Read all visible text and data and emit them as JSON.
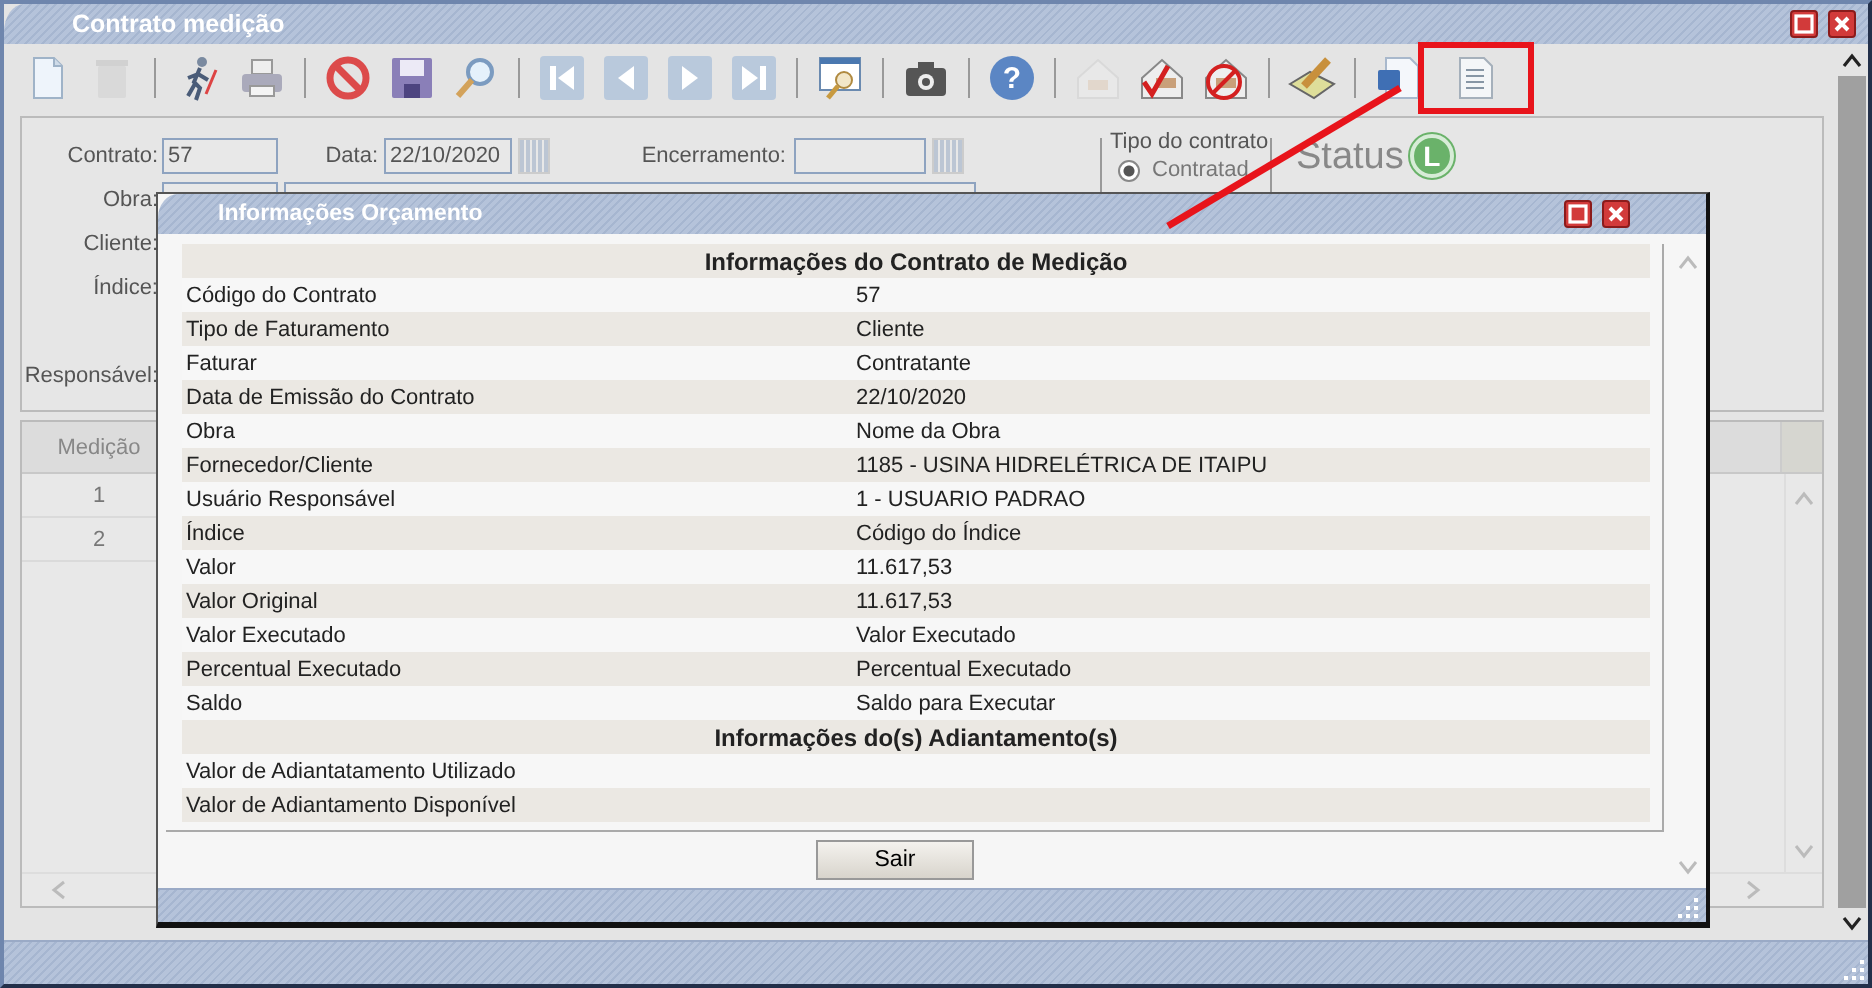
{
  "window": {
    "title": "Contrato medição"
  },
  "toolbar": [
    {
      "kind": "new",
      "disabled": false,
      "highlighted": false
    },
    {
      "kind": "delete",
      "disabled": true,
      "highlighted": false
    },
    {
      "kind": "separator"
    },
    {
      "kind": "runner",
      "disabled": false,
      "highlighted": false
    },
    {
      "kind": "print",
      "disabled": false,
      "highlighted": false
    },
    {
      "kind": "separator"
    },
    {
      "kind": "cancel",
      "disabled": false,
      "highlighted": false
    },
    {
      "kind": "save",
      "disabled": false,
      "highlighted": false
    },
    {
      "kind": "search",
      "disabled": false,
      "highlighted": false
    },
    {
      "kind": "separator"
    },
    {
      "kind": "first",
      "disabled": false,
      "highlighted": false
    },
    {
      "kind": "prev",
      "disabled": false,
      "highlighted": false
    },
    {
      "kind": "next",
      "disabled": false,
      "highlighted": false
    },
    {
      "kind": "last",
      "disabled": false,
      "highlighted": false
    },
    {
      "kind": "separator"
    },
    {
      "kind": "preview",
      "disabled": false,
      "highlighted": false
    },
    {
      "kind": "separator"
    },
    {
      "kind": "camera",
      "disabled": false,
      "highlighted": false
    },
    {
      "kind": "separator"
    },
    {
      "kind": "help",
      "glyph": "?",
      "disabled": false,
      "highlighted": false
    },
    {
      "kind": "separator"
    },
    {
      "kind": "house",
      "disabled": true,
      "highlighted": false
    },
    {
      "kind": "house-check",
      "disabled": false,
      "highlighted": false
    },
    {
      "kind": "house-block",
      "disabled": false,
      "highlighted": false
    },
    {
      "kind": "separator"
    },
    {
      "kind": "edit",
      "disabled": false,
      "highlighted": false
    },
    {
      "kind": "separator"
    },
    {
      "kind": "word",
      "disabled": false,
      "highlighted": false
    },
    {
      "kind": "report",
      "disabled": false,
      "highlighted": true
    }
  ],
  "form": {
    "contrato_label": "Contrato:",
    "contrato": "57",
    "data_label": "Data:",
    "data": "22/10/2020",
    "encerramento_label": "Encerramento:",
    "obra_label": "Obra:",
    "cliente_label": "Cliente:",
    "indice_label": "Índice:",
    "responsavel_label": "Responsável:",
    "tipo_legend": "Tipo do contrato",
    "tipo_option": {
      "label": "Contratad",
      "selected": true
    },
    "status_label": "Status",
    "status_badge": "L"
  },
  "grid": {
    "columns": [
      "Medição"
    ],
    "rows": [
      "1",
      "2"
    ]
  },
  "dialog": {
    "title": "Informações Orçamento",
    "sections": [
      {
        "heading": "Informações do Contrato de Medição",
        "rows": [
          {
            "label": "Código do Contrato",
            "value": "57"
          },
          {
            "label": "Tipo de Faturamento",
            "value": "Cliente"
          },
          {
            "label": "Faturar",
            "value": "Contratante"
          },
          {
            "label": "Data de Emissão do Contrato",
            "value": "22/10/2020"
          },
          {
            "label": "Obra",
            "value": "Nome da Obra"
          },
          {
            "label": "Fornecedor/Cliente",
            "value": "1185 - USINA HIDRELÉTRICA DE ITAIPU"
          },
          {
            "label": "Usuário Responsável",
            "value": "1 - USUARIO PADRAO"
          },
          {
            "label": "Índice",
            "value": "Código do Índice"
          },
          {
            "label": "Valor",
            "value": "11.617,53"
          },
          {
            "label": "Valor Original",
            "value": "11.617,53"
          },
          {
            "label": "Valor Executado",
            "value": "Valor Executado"
          },
          {
            "label": "Percentual Executado",
            "value": "Percentual Executado"
          },
          {
            "label": "Saldo",
            "value": "Saldo para Executar"
          }
        ]
      },
      {
        "heading": "Informações do(s) Adiantamento(s)",
        "rows": [
          {
            "label": "Valor de Adiantatamento Utilizado"
          },
          {
            "label": "Valor de Adiantamento Disponível"
          }
        ]
      }
    ],
    "button": "Sair"
  }
}
